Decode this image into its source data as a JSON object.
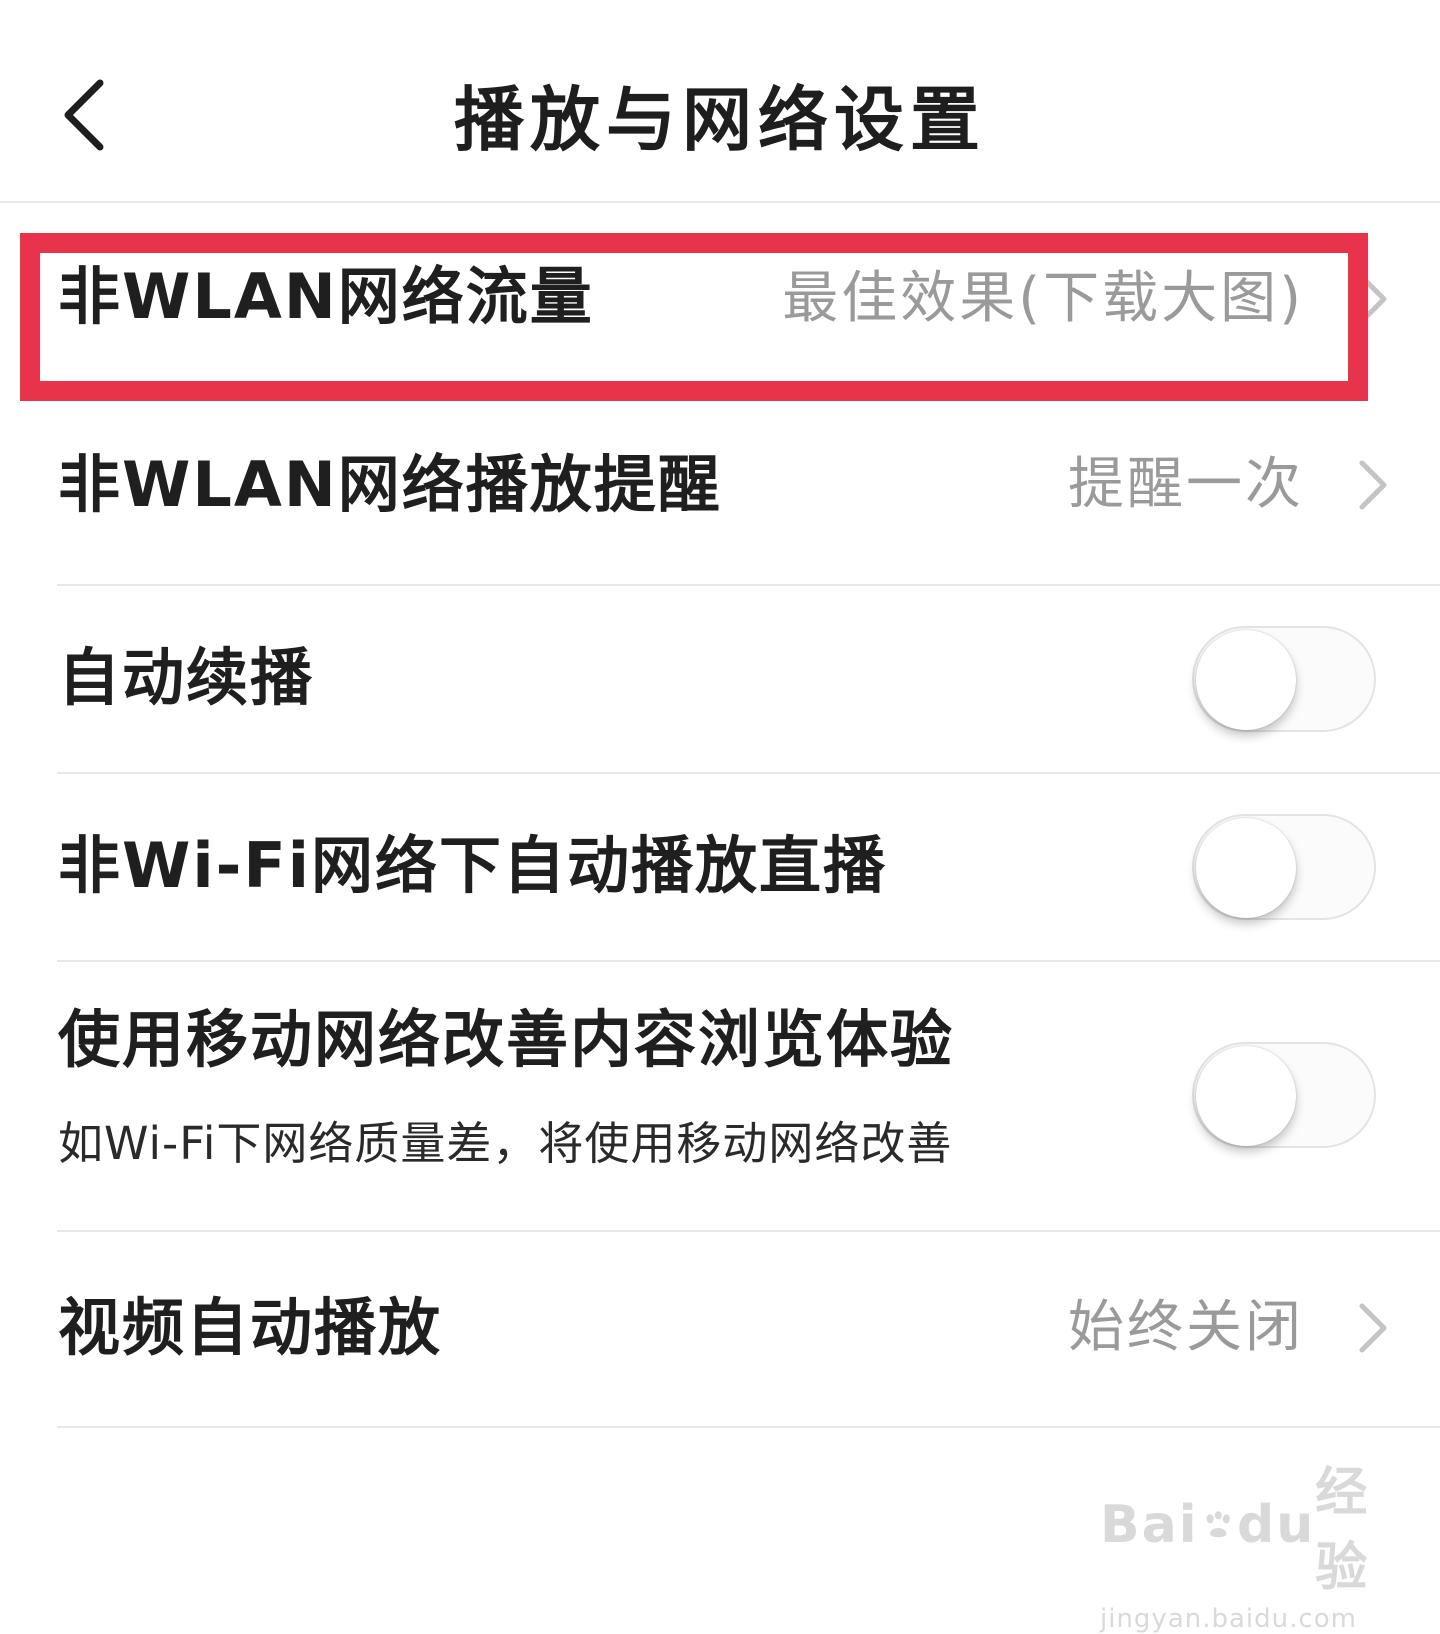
{
  "header": {
    "title": "播放与网络设置",
    "back_icon": "chevron-left-icon"
  },
  "settings": [
    {
      "id": "non-wlan-traffic",
      "label": "非WLAN网络流量",
      "value": "最佳效果(下载大图)",
      "control": "chevron-right-icon"
    },
    {
      "id": "non-wlan-play-reminder",
      "label": "非WLAN网络播放提醒",
      "value": "提醒一次",
      "control": "chevron-right-icon"
    },
    {
      "id": "auto-continue-play",
      "label": "自动续播",
      "control": "toggle",
      "enabled": false
    },
    {
      "id": "non-wifi-autoplay-live",
      "label": "非Wi-Fi网络下自动播放直播",
      "control": "toggle",
      "enabled": false
    },
    {
      "id": "mobile-network-improve",
      "label": "使用移动网络改善内容浏览体验",
      "sublabel": "如Wi-Fi下网络质量差，将使用移动网络改善",
      "control": "toggle",
      "enabled": false
    },
    {
      "id": "video-autoplay",
      "label": "视频自动播放",
      "value": "始终关闭",
      "control": "chevron-right-icon"
    }
  ],
  "highlight": {
    "target": "non-wlan-traffic",
    "color": "#e7344b"
  },
  "watermark": {
    "brand_left": "Bai",
    "brand_mid": "du",
    "brand_right": "经验",
    "url": "jingyan.baidu.com",
    "icon": "baidu-paw-icon"
  },
  "colors": {
    "text_primary": "#1f1f1f",
    "text_secondary": "#9a9a9a",
    "divider": "#e8e8e8",
    "toggle_off": "#fbfbfb"
  }
}
